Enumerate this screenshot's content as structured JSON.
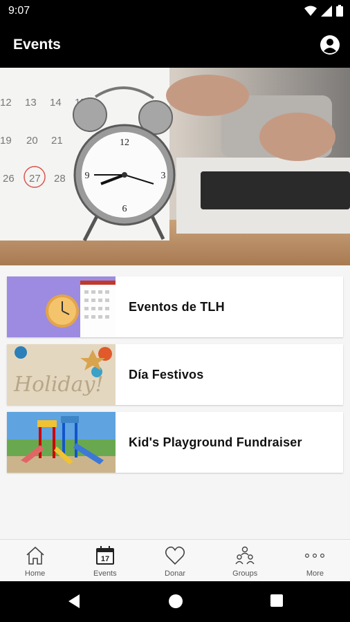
{
  "status_bar": {
    "time": "9:07"
  },
  "app_bar": {
    "title": "Events"
  },
  "events": [
    {
      "title": "Eventos de TLH"
    },
    {
      "title": "Día Festivos"
    },
    {
      "title": "Kid's Playground Fundraiser"
    }
  ],
  "hero": {
    "calendar_numbers": [
      "12",
      "13",
      "14",
      "15",
      "19",
      "20",
      "21",
      "26",
      "27",
      "28"
    ]
  },
  "bottom_nav": [
    {
      "label": "Home",
      "icon": "home-icon"
    },
    {
      "label": "Events",
      "icon": "calendar-icon",
      "icon_text": "17"
    },
    {
      "label": "Donar",
      "icon": "heart-icon"
    },
    {
      "label": "Groups",
      "icon": "groups-icon"
    },
    {
      "label": "More",
      "icon": "more-dots-icon"
    }
  ],
  "thumb_texts": {
    "holiday": "Holiday!"
  },
  "colors": {
    "bar_bg": "#000000",
    "page_bg": "#f5f5f5",
    "card_bg": "#ffffff"
  }
}
